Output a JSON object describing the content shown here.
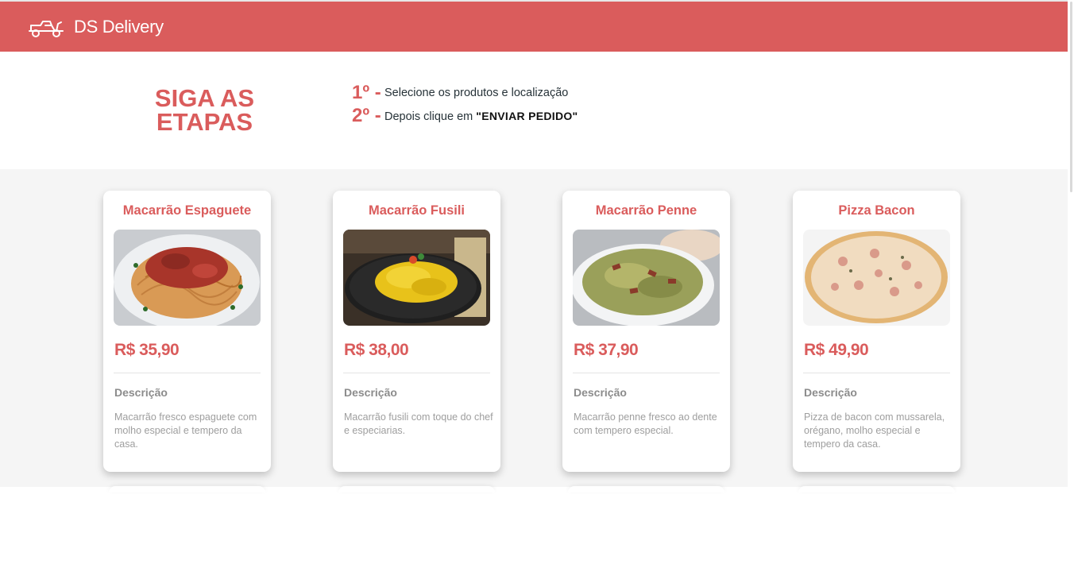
{
  "header": {
    "logo_icon": "scooter-icon",
    "title": "DS Delivery"
  },
  "steps": {
    "title": "SIGA AS ETAPAS",
    "items": [
      {
        "number": "1º -",
        "text": "Selecione os produtos e localização",
        "emphasis": ""
      },
      {
        "number": "2º -",
        "text": "Depois clique em ",
        "emphasis": "\"ENVIAR PEDIDO\""
      }
    ]
  },
  "products": [
    {
      "name": "Macarrão Espaguete",
      "price": "R$ 35,90",
      "description_label": "Descrição",
      "description": "Macarrão fresco espaguete com molho especial e tempero da casa."
    },
    {
      "name": "Macarrão Fusili",
      "price": "R$ 38,00",
      "description_label": "Descrição",
      "description": "Macarrão fusili com toque do chef e especiarias."
    },
    {
      "name": "Macarrão Penne",
      "price": "R$ 37,90",
      "description_label": "Descrição",
      "description": "Macarrão penne fresco ao dente com tempero especial."
    },
    {
      "name": "Pizza Bacon",
      "price": "R$ 49,90",
      "description_label": "Descrição",
      "description": "Pizza de bacon com mussarela, orégano, molho especial e tempero da casa."
    }
  ],
  "colors": {
    "primary": "#da5c5c",
    "catalog_background": "#f5f5f5",
    "text": "#263238"
  }
}
